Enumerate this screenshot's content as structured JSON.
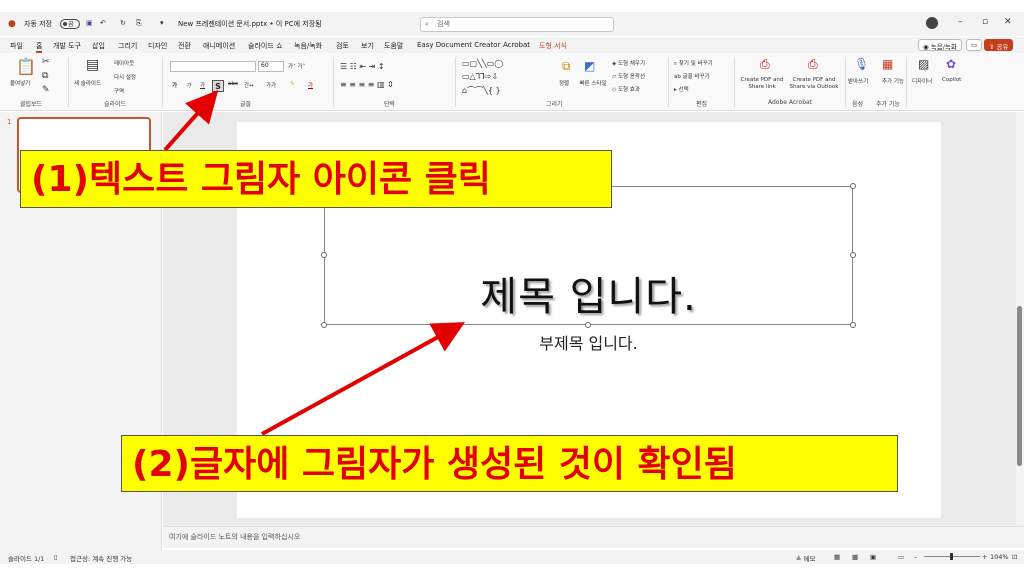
{
  "titlebar": {
    "autosave": "자동 저장",
    "toggle": "끔",
    "doc_title": "New 프레젠테이션 문서.pptx • 이 PC에 저장됨",
    "search_placeholder": "검색"
  },
  "menubar": {
    "tabs": [
      "파일",
      "홈",
      "개발 도구",
      "삽입",
      "그리기",
      "디자인",
      "전환",
      "애니메이션",
      "슬라이드 쇼",
      "녹음/녹화",
      "검토",
      "보기",
      "도움말",
      "Easy Document Creator",
      "Acrobat",
      "도형 서식"
    ],
    "record_btn": "녹음/녹화",
    "share_btn": "공유"
  },
  "ribbon": {
    "groups": [
      "클립보드",
      "슬라이드",
      "글꼴",
      "단락",
      "그리기",
      "편집",
      "Adobe Acrobat",
      "음성",
      "추가 기능"
    ],
    "paste": "붙여넣기",
    "new_slide": "새 슬라이드",
    "layout": "레이아웃",
    "reset": "다시 설정",
    "section": "구역",
    "font_size": "60",
    "arrange": "정렬",
    "quick_styles": "빠른 스타일",
    "shape_fill": "도형 채우기",
    "shape_outline": "도형 윤곽선",
    "shape_effects": "도형 효과",
    "find": "찾기 및 바꾸기",
    "replace_font": "글꼴 바꾸기",
    "select": "선택",
    "create_pdf_link": "Create PDF and Share link",
    "create_pdf_outlook": "Create PDF and Share via Outlook",
    "dictate": "받아쓰기",
    "addins": "추가 기능",
    "designer": "디자이너",
    "copilot": "Copilot"
  },
  "slide": {
    "title": "제목 입니다.",
    "subtitle": "부제목 입니다."
  },
  "thumb_number": "1",
  "notes_placeholder": "여기에 슬라이드 노트의 내용을 입력하십시오",
  "status": {
    "slide": "슬라이드 1/1",
    "accessibility": "접근성: 계속 진행 가능",
    "notes_btn": "메모",
    "zoom": "104%"
  },
  "callouts": {
    "step1": "(1)텍스트 그림자 아이콘 클릭",
    "step2": "(2)글자에 그림자가 생성된 것이 확인됨"
  },
  "colors": {
    "accent": "#c43e1c",
    "callout_bg": "#ffff00",
    "callout_text": "#e30000",
    "arrow": "#e30000"
  }
}
